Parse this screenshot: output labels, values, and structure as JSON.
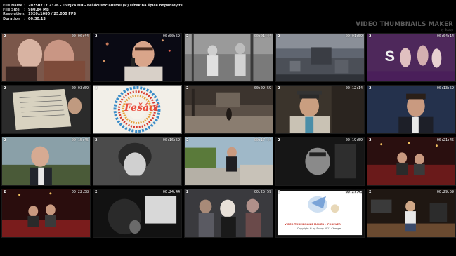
{
  "info": {
    "rows": [
      {
        "key": "File Name",
        "value": "20250717 2326 - Dvojka HD - Fešáci socialismu (R) Dítek na špice.hdpanidy.ts"
      },
      {
        "key": "File Size",
        "value": "980.84 MB"
      },
      {
        "key": "Resolution",
        "value": "1920x1080 / 25.000 FPS"
      },
      {
        "key": "Duration",
        "value": "00:30:13"
      }
    ],
    "separator": ":"
  },
  "brand": {
    "title": "VIDEO THUMBNAILS MAKER",
    "subtitle": "by Scoop"
  },
  "thumbnails": [
    {
      "channel": "2",
      "time": "00:00:44"
    },
    {
      "channel": "2",
      "time": "00:00:59"
    },
    {
      "channel": "2",
      "time": "00:01:44"
    },
    {
      "channel": "2",
      "time": "00:01:59"
    },
    {
      "channel": "2",
      "time": "00:04:14"
    },
    {
      "channel": "2",
      "time": "00:03:59"
    },
    {
      "channel": "2",
      "time": "",
      "frame_title": "Fešáci"
    },
    {
      "channel": "2",
      "time": "00:09:59"
    },
    {
      "channel": "2",
      "time": "00:12:14"
    },
    {
      "channel": "2",
      "time": "00:13:59"
    },
    {
      "channel": "2",
      "time": "00:15:45"
    },
    {
      "channel": "2",
      "time": "00:16:59"
    },
    {
      "channel": "2",
      "time": "00:17:44"
    },
    {
      "channel": "2",
      "time": "00:19:59"
    },
    {
      "channel": "2",
      "time": "00:21:45"
    },
    {
      "channel": "2",
      "time": "00:22:58"
    },
    {
      "channel": "2",
      "time": "00:24:44"
    },
    {
      "channel": "2",
      "time": "00:25:59"
    },
    {
      "channel": "2",
      "time": "00:27:43"
    },
    {
      "channel": "2",
      "time": "00:29:59"
    }
  ],
  "vtm_card": {
    "title": "VIDEO THUMBNAILS MAKER • FOREVER",
    "copyright": "Copyright © by Scoop 2011 Changes"
  },
  "colors": {
    "background": "#000000",
    "accent": "#e94b3c",
    "brand": "#5b5b5b"
  }
}
